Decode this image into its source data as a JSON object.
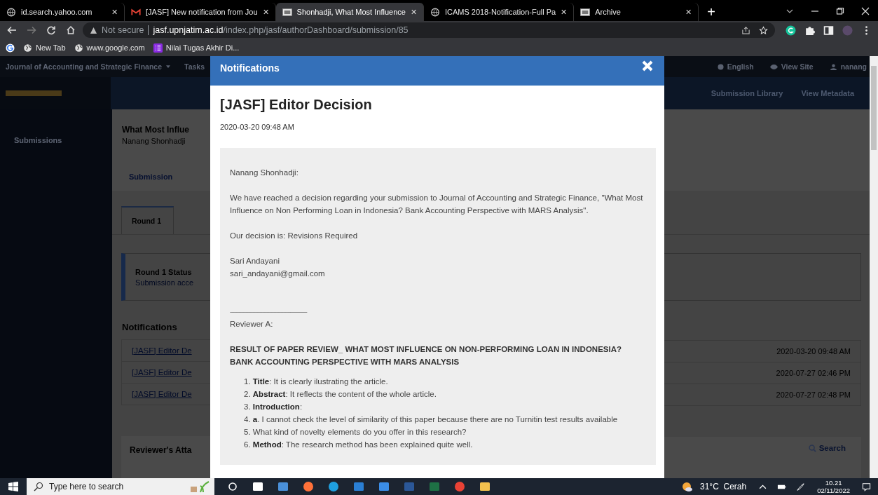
{
  "browser": {
    "tabs": [
      {
        "title": "id.search.yahoo.com",
        "close": "✕",
        "selected": false
      },
      {
        "title": "[JASF] New notification from Jou",
        "close": "✕",
        "selected": false
      },
      {
        "title": "Shonhadji, What Most Influence",
        "close": "✕",
        "selected": true
      },
      {
        "title": "ICAMS 2018-Notification-Full Pa",
        "close": "✕",
        "selected": false
      },
      {
        "title": "Archive",
        "close": "✕",
        "selected": false
      }
    ],
    "new_tab": "+",
    "security": "Not secure",
    "url_host": "jasf.upnjatim.ac.id",
    "url_path": "/index.php/jasf/authorDashboard/submission/85",
    "bookmarks": [
      {
        "label": "New Tab"
      },
      {
        "label": "www.google.com"
      },
      {
        "label": "Nilai Tugas Akhir Di..."
      }
    ]
  },
  "site": {
    "journal_menu": "Journal of Accounting and Strategic Finance",
    "tasks": "Tasks",
    "language": "English",
    "view_site": "View Site",
    "user": "nanang",
    "header_links": [
      "Submission Library",
      "View Metadata"
    ],
    "sidebar": [
      {
        "label": "Submissions"
      }
    ],
    "submission_title": "What Most Influe",
    "author": "Nanang Shonhadji",
    "stage_tab": "Submission",
    "round_tab": "Round 1",
    "status_title": "Round 1 Status",
    "status_text": "Submission acce",
    "notifications_heading": "Notifications",
    "notifications": [
      {
        "title": "[JASF] Editor De",
        "date": "2020-03-20 09:48 AM"
      },
      {
        "title": "[JASF] Editor De",
        "date": "2020-07-27 02:46 PM"
      },
      {
        "title": "[JASF] Editor De",
        "date": "2020-07-27 02:48 PM"
      }
    ],
    "attachments_heading": "Reviewer's Atta",
    "search": "Search"
  },
  "modal": {
    "header": "Notifications",
    "subject": "[JASF] Editor Decision",
    "date": "2020-03-20 09:48 AM",
    "body": [
      {
        "kind": "para",
        "text": "Nanang Shonhadji:"
      },
      {
        "kind": "para",
        "text": "We have reached a decision regarding your submission to Journal of Accounting and Strategic Finance, \"What Most Influence on Non Performing Loan in Indonesia? Bank Accounting Perspective with MARS Analysis\"."
      },
      {
        "kind": "para",
        "text": "Our decision is: Revisions Required"
      },
      {
        "kind": "lines",
        "lines": [
          "Sari Andayani",
          "sari_andayani@gmail.com"
        ]
      },
      {
        "kind": "rule",
        "text": "-------------------------------------------------------"
      },
      {
        "kind": "para",
        "text": "Reviewer A:"
      },
      {
        "kind": "heading",
        "text": "RESULT OF PAPER REVIEW_ WHAT MOST INFLUENCE ON NON-PERFORMING LOAN IN INDONESIA? BANK ACCOUNTING PERSPECTIVE WITH MARS ANALYSIS"
      },
      {
        "kind": "list",
        "items": [
          {
            "number": "1.",
            "text": "**Title**: It is clearly ilustrating the article."
          },
          {
            "number": "2.",
            "text": "**Abstract**: It reflects the content of the whole article."
          },
          {
            "number": "3.",
            "text": "**Introduction**:"
          },
          {
            "number": "4.",
            "text": "**a**. I cannot check the level of similarity of this paper because there are no Turnitin test results available"
          },
          {
            "number": "5.",
            "text": "What kind of novelty elements do you offer in this research?"
          },
          {
            "number": "6.",
            "text": "**Method**: The research method has been explained quite well."
          }
        ]
      }
    ]
  },
  "taskbar": {
    "search_placeholder": "Type here to search",
    "weather": "31°C  Cerah",
    "time": "10.21",
    "date": "02/11/2022"
  }
}
